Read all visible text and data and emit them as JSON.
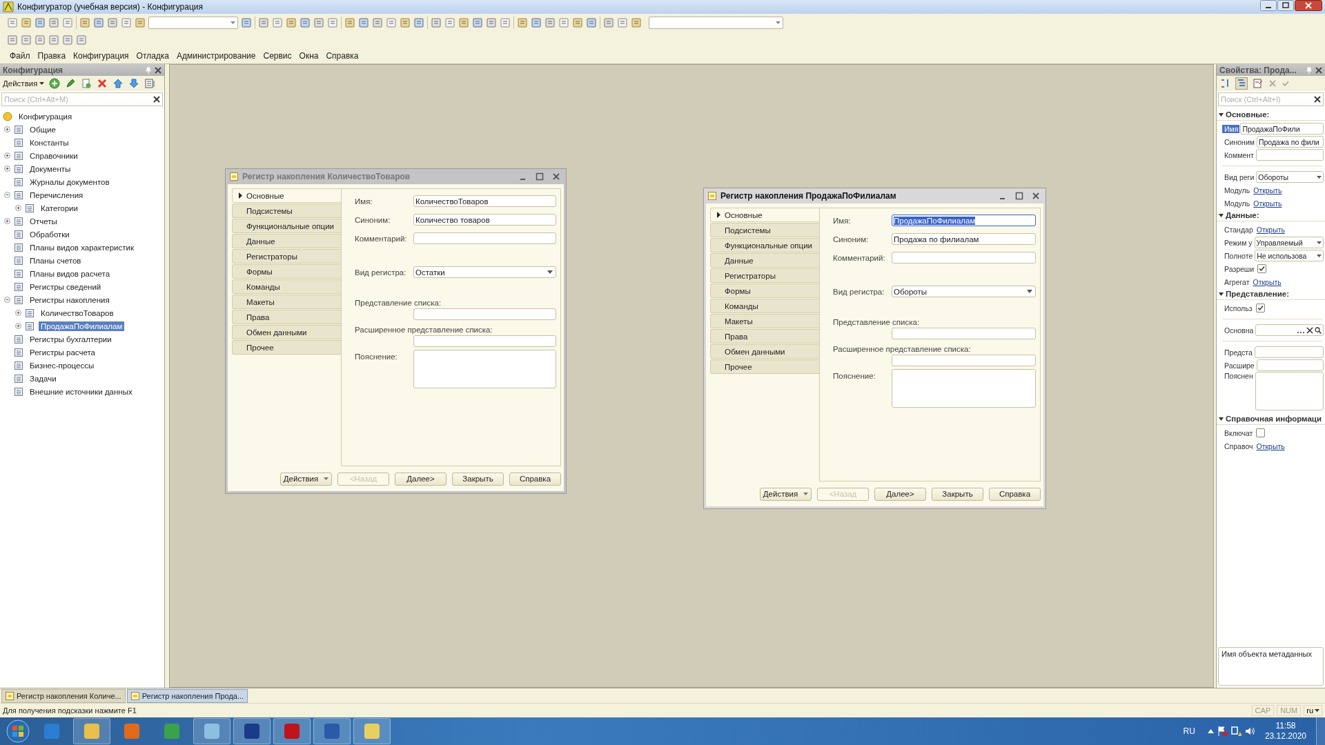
{
  "window": {
    "title": "Конфигуратор (учебная версия) - Конфигурация"
  },
  "menu": [
    "Файл",
    "Правка",
    "Конфигурация",
    "Отладка",
    "Администрирование",
    "Сервис",
    "Окна",
    "Справка"
  ],
  "config_panel": {
    "title": "Конфигурация",
    "actions": "Действия",
    "search": {
      "placeholder": "Поиск (Ctrl+Alt+M)"
    },
    "tree": [
      {
        "label": "Конфигурация",
        "selected": false,
        "children": [
          {
            "label": "Общие",
            "expanded": false,
            "selected": false
          },
          {
            "label": "Константы",
            "selected": false
          },
          {
            "label": "Справочники",
            "expanded": false,
            "selected": false
          },
          {
            "label": "Документы",
            "expanded": false,
            "selected": false
          },
          {
            "label": "Журналы документов",
            "selected": false
          },
          {
            "label": "Перечисления",
            "expanded": true,
            "selected": false,
            "children": [
              {
                "label": "Категории",
                "expanded": false,
                "selected": false
              }
            ]
          },
          {
            "label": "Отчеты",
            "expanded": false,
            "selected": false
          },
          {
            "label": "Обработки",
            "selected": false
          },
          {
            "label": "Планы видов характеристик",
            "selected": false
          },
          {
            "label": "Планы счетов",
            "selected": false
          },
          {
            "label": "Планы видов расчета",
            "selected": false
          },
          {
            "label": "Регистры сведений",
            "selected": false
          },
          {
            "label": "Регистры накопления",
            "expanded": true,
            "selected": false,
            "children": [
              {
                "label": "КоличествоТоваров",
                "expanded": false,
                "selected": false
              },
              {
                "label": "ПродажаПоФилиалам",
                "expanded": false,
                "selected": true
              }
            ]
          },
          {
            "label": "Регистры бухгалтерии",
            "selected": false
          },
          {
            "label": "Регистры расчета",
            "selected": false
          },
          {
            "label": "Бизнес-процессы",
            "selected": false
          },
          {
            "label": "Задачи",
            "selected": false
          },
          {
            "label": "Внешние источники данных",
            "selected": false
          }
        ]
      }
    ]
  },
  "dialogs": [
    {
      "title": "Регистр накопления КоличествоТоваров",
      "active": false,
      "tabs": [
        {
          "label": "Основные",
          "selected": true
        },
        {
          "label": "Подсистемы",
          "selected": false
        },
        {
          "label": "Функциональные опции",
          "selected": false
        },
        {
          "label": "Данные",
          "selected": false
        },
        {
          "label": "Регистраторы",
          "selected": false
        },
        {
          "label": "Формы",
          "selected": false
        },
        {
          "label": "Команды",
          "selected": false
        },
        {
          "label": "Макеты",
          "selected": false
        },
        {
          "label": "Права",
          "selected": false
        },
        {
          "label": "Обмен данными",
          "selected": false
        },
        {
          "label": "Прочее",
          "selected": false
        }
      ],
      "fields": [
        {
          "label": "Имя:",
          "kind": "text",
          "value": "КоличествоТоваров",
          "highlighted": false
        },
        {
          "label": "Синоним:",
          "kind": "text",
          "value": "Количество товаров",
          "highlighted": false
        },
        {
          "label": "Комментарий:",
          "kind": "text"
        },
        {
          "label": "Вид регистра:",
          "kind": "select",
          "value": "Остатки",
          "highlighted": false
        },
        {
          "label": "Представление списка:",
          "kind": "stacked"
        },
        {
          "label": "Расширенное представление списка:",
          "kind": "stacked"
        },
        {
          "label": "Пояснение:",
          "kind": "textarea"
        }
      ],
      "buttons": [
        {
          "label": "Действия",
          "kind": "menu",
          "disabled": false
        },
        {
          "label": "<Назад",
          "kind": "push",
          "disabled": true
        },
        {
          "label": "Далее>",
          "kind": "push",
          "disabled": false
        },
        {
          "label": "Закрыть",
          "kind": "push",
          "disabled": false
        },
        {
          "label": "Справка",
          "kind": "push",
          "disabled": false
        }
      ]
    },
    {
      "title": "Регистр накопления ПродажаПоФилиалам",
      "active": true,
      "tabs": [
        {
          "label": "Основные",
          "selected": true
        },
        {
          "label": "Подсистемы",
          "selected": false
        },
        {
          "label": "Функциональные опции",
          "selected": false
        },
        {
          "label": "Данные",
          "selected": false
        },
        {
          "label": "Регистраторы",
          "selected": false
        },
        {
          "label": "Формы",
          "selected": false
        },
        {
          "label": "Команды",
          "selected": false
        },
        {
          "label": "Макеты",
          "selected": false
        },
        {
          "label": "Права",
          "selected": false
        },
        {
          "label": "Обмен данными",
          "selected": false
        },
        {
          "label": "Прочее",
          "selected": false
        }
      ],
      "fields": [
        {
          "label": "Имя:",
          "kind": "text",
          "value": "ПродажаПоФилиалам",
          "highlighted": true
        },
        {
          "label": "Синоним:",
          "kind": "text",
          "value": "Продажа по филиалам",
          "highlighted": false
        },
        {
          "label": "Комментарий:",
          "kind": "text"
        },
        {
          "label": "Вид регистра:",
          "kind": "select",
          "value": "Обороты",
          "highlighted": false
        },
        {
          "label": "Представление списка:",
          "kind": "stacked"
        },
        {
          "label": "Расширенное представление списка:",
          "kind": "stacked"
        },
        {
          "label": "Пояснение:",
          "kind": "textarea"
        }
      ],
      "buttons": [
        {
          "label": "Действия",
          "kind": "menu",
          "disabled": false
        },
        {
          "label": "<Назад",
          "kind": "push",
          "disabled": true
        },
        {
          "label": "Далее>",
          "kind": "push",
          "disabled": false
        },
        {
          "label": "Закрыть",
          "kind": "push",
          "disabled": false
        },
        {
          "label": "Справка",
          "kind": "push",
          "disabled": false
        }
      ]
    }
  ],
  "properties": {
    "title": "Свойства: Прода...",
    "search": {
      "placeholder": "Поиск (Ctrl+Alt+I)"
    },
    "sections": [
      {
        "title": "Основные:",
        "expanded": true,
        "rows": [
          {
            "kind": "text",
            "label": "Имя",
            "value": "ПродажаПоФили",
            "selected": true
          },
          {
            "kind": "text",
            "label": "Синоним",
            "value": "Продажа по фили",
            "selected": false
          },
          {
            "kind": "text",
            "label": "Коммент",
            "selected": false
          },
          {
            "kind": "separator"
          },
          {
            "kind": "select",
            "label": "Вид реги",
            "value": "Обороты",
            "selected": false
          },
          {
            "kind": "link",
            "label": "Модуль",
            "value": "Открыть",
            "selected": false
          },
          {
            "kind": "link",
            "label": "Модуль",
            "value": "Открыть",
            "selected": false
          }
        ]
      },
      {
        "title": "Данные:",
        "expanded": true,
        "rows": [
          {
            "kind": "link",
            "label": "Стандар",
            "value": "Открыть",
            "selected": false
          },
          {
            "kind": "select",
            "label": "Режим у",
            "value": "Управляемый",
            "selected": false
          },
          {
            "kind": "select",
            "label": "Полноте",
            "value": "Не использова",
            "selected": false
          },
          {
            "kind": "checkbox",
            "label": "Разреши",
            "checked": true,
            "selected": false
          },
          {
            "kind": "link",
            "label": "Агрегат",
            "value": "Открыть",
            "selected": false
          }
        ]
      },
      {
        "title": "Представление:",
        "expanded": true,
        "rows": [
          {
            "kind": "checkbox",
            "label": "Использ",
            "checked": true,
            "selected": false
          },
          {
            "kind": "separator"
          },
          {
            "kind": "picker",
            "label": "Основна",
            "selected": false
          },
          {
            "kind": "separator"
          },
          {
            "kind": "text",
            "label": "Предста",
            "selected": false
          },
          {
            "kind": "text",
            "label": "Расшире",
            "selected": false
          },
          {
            "kind": "textarea",
            "label": "Пояснен",
            "selected": false
          }
        ]
      },
      {
        "title": "Справочная информаци",
        "expanded": true,
        "rows": [
          {
            "kind": "checkbox",
            "label": "Включат",
            "checked": false,
            "selected": false
          },
          {
            "kind": "link",
            "label": "Справоч",
            "value": "Открыть",
            "selected": false
          }
        ]
      }
    ],
    "description": "Имя объекта метаданных"
  },
  "open_windows": [
    {
      "label": "Регистр накопления Количе...",
      "selected": false
    },
    {
      "label": "Регистр накопления Прода...",
      "selected": true
    }
  ],
  "status_bar": {
    "hint": "Для получения подсказки нажмите F1",
    "indicators": [
      "CAP",
      "NUM"
    ],
    "language": "ru"
  },
  "taskbar": {
    "language": "RU",
    "time": "11:58",
    "date": "23.12.2020"
  }
}
